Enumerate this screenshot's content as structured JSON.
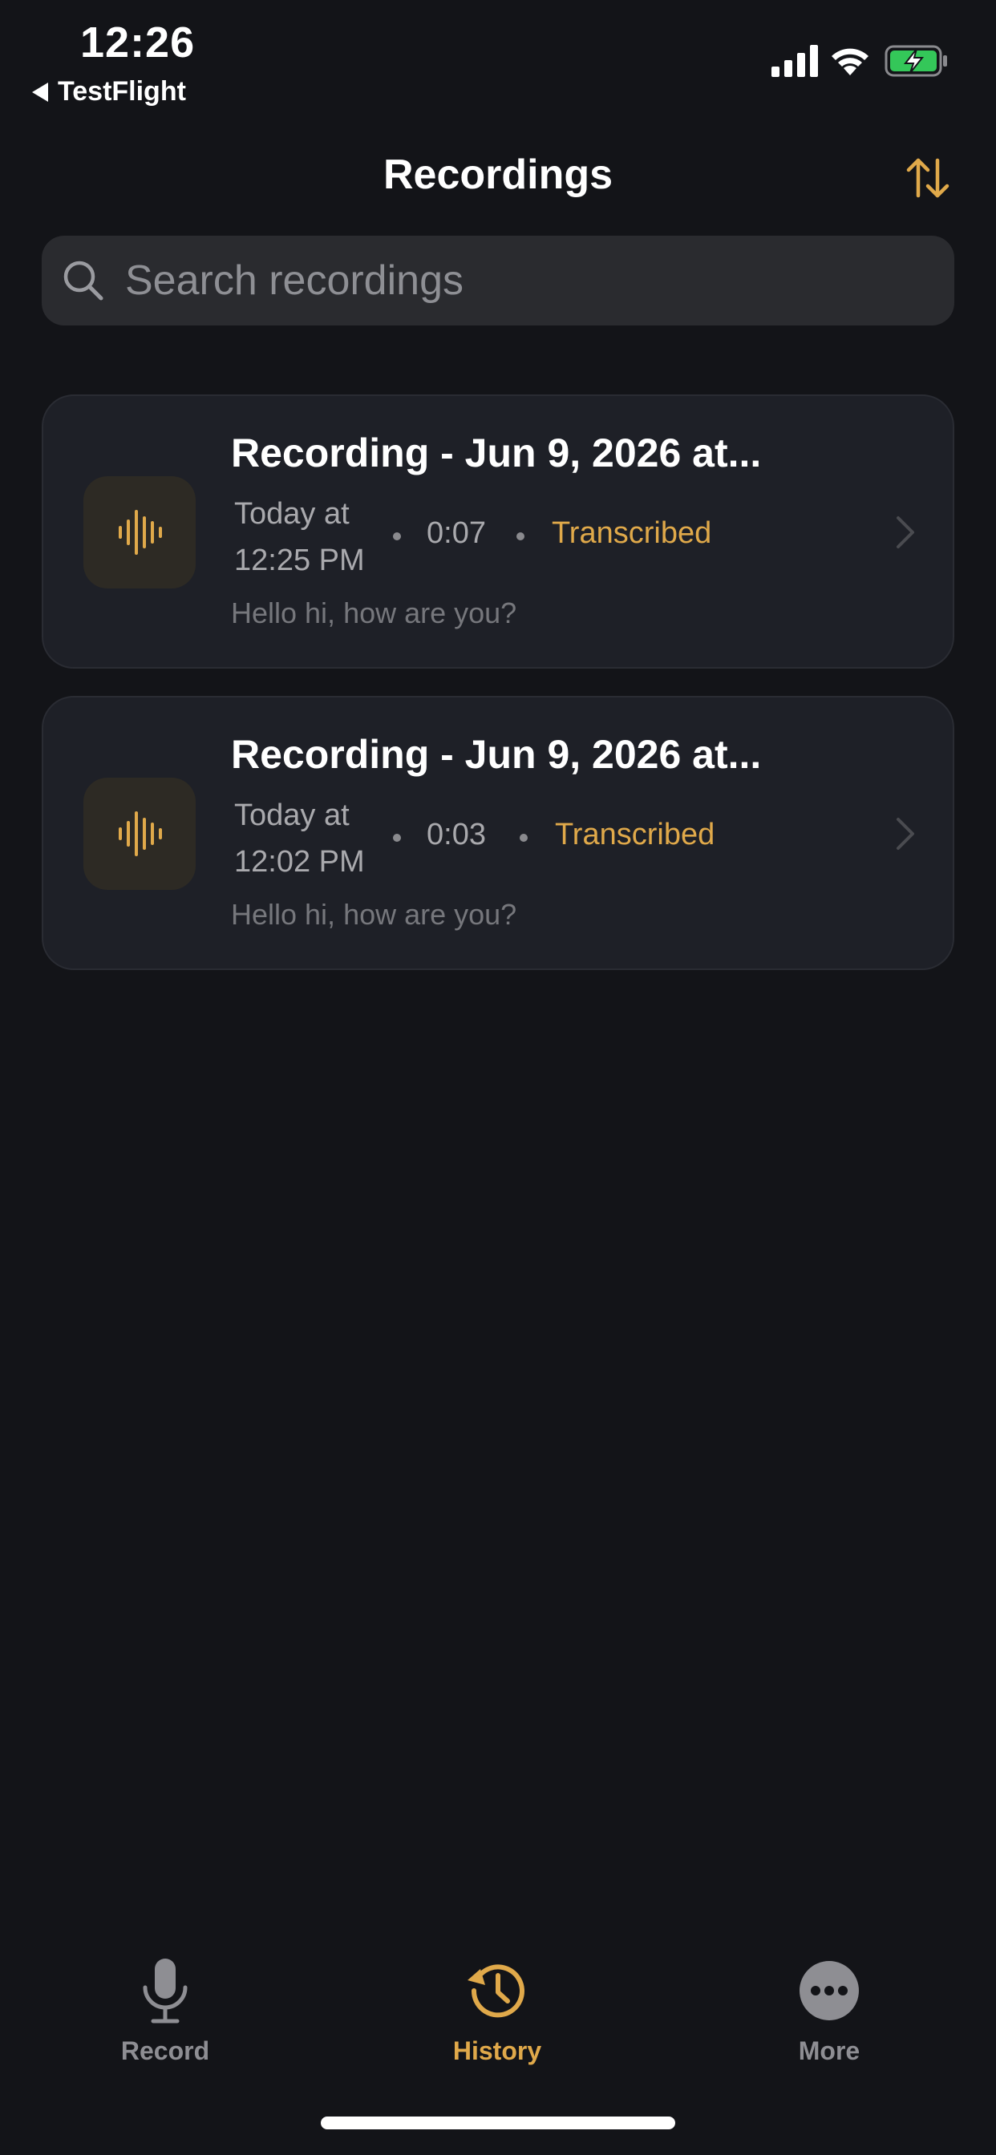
{
  "status_bar": {
    "time": "12:26",
    "back_app": "TestFlight"
  },
  "header": {
    "title": "Recordings"
  },
  "search": {
    "placeholder": "Search recordings",
    "value": ""
  },
  "recordings": [
    {
      "title": "Recording - Jun 9, 2026 at...",
      "date_line1": "Today at",
      "date_line2": "12:25 PM",
      "duration": "0:07",
      "status": "Transcribed",
      "preview": "Hello hi, how are you?"
    },
    {
      "title": "Recording - Jun 9, 2026 at...",
      "date_line1": "Today at",
      "date_line2": "12:02 PM",
      "duration": "0:03",
      "status": "Transcribed",
      "preview": "Hello hi, how are you?"
    }
  ],
  "tabs": [
    {
      "label": "Record",
      "icon": "microphone-icon",
      "active": false
    },
    {
      "label": "History",
      "icon": "history-icon",
      "active": true
    },
    {
      "label": "More",
      "icon": "more-icon",
      "active": false
    }
  ],
  "colors": {
    "background": "#131418",
    "card": "#1e2027",
    "accent": "#e0a94a",
    "inactive_tab": "#8e8e93",
    "battery_green": "#34c759"
  }
}
